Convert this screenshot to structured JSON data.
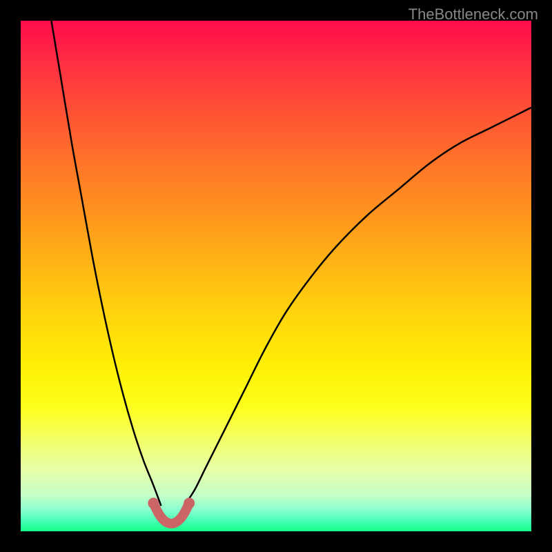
{
  "watermark": "TheBottleneck.com",
  "colors": {
    "background": "#000000",
    "curve": "#000000",
    "marker": "#cc6666"
  },
  "chart_data": {
    "type": "line",
    "title": "",
    "xlabel": "",
    "ylabel": "",
    "xlim": [
      0,
      100
    ],
    "ylim": [
      0,
      100
    ],
    "series": [
      {
        "name": "left-curve",
        "x": [
          6,
          8,
          10,
          12,
          14,
          16,
          18,
          20,
          22,
          24,
          26,
          27.5
        ],
        "values": [
          100,
          88,
          76,
          65,
          54,
          44,
          35,
          27,
          20,
          14,
          9,
          5
        ]
      },
      {
        "name": "right-curve",
        "x": [
          32,
          34,
          36,
          38,
          41,
          44,
          48,
          52,
          57,
          62,
          68,
          74,
          80,
          86,
          92,
          98,
          100
        ],
        "values": [
          5,
          8,
          12,
          16,
          22,
          28,
          36,
          43,
          50,
          56,
          62,
          67,
          72,
          76,
          79,
          82,
          83
        ]
      },
      {
        "name": "bottleneck-marker",
        "x": [
          26,
          27,
          28,
          29,
          30,
          31,
          32,
          33
        ],
        "values": [
          5.5,
          3.5,
          2.2,
          1.6,
          1.6,
          2.2,
          3.5,
          5.5
        ]
      }
    ]
  }
}
